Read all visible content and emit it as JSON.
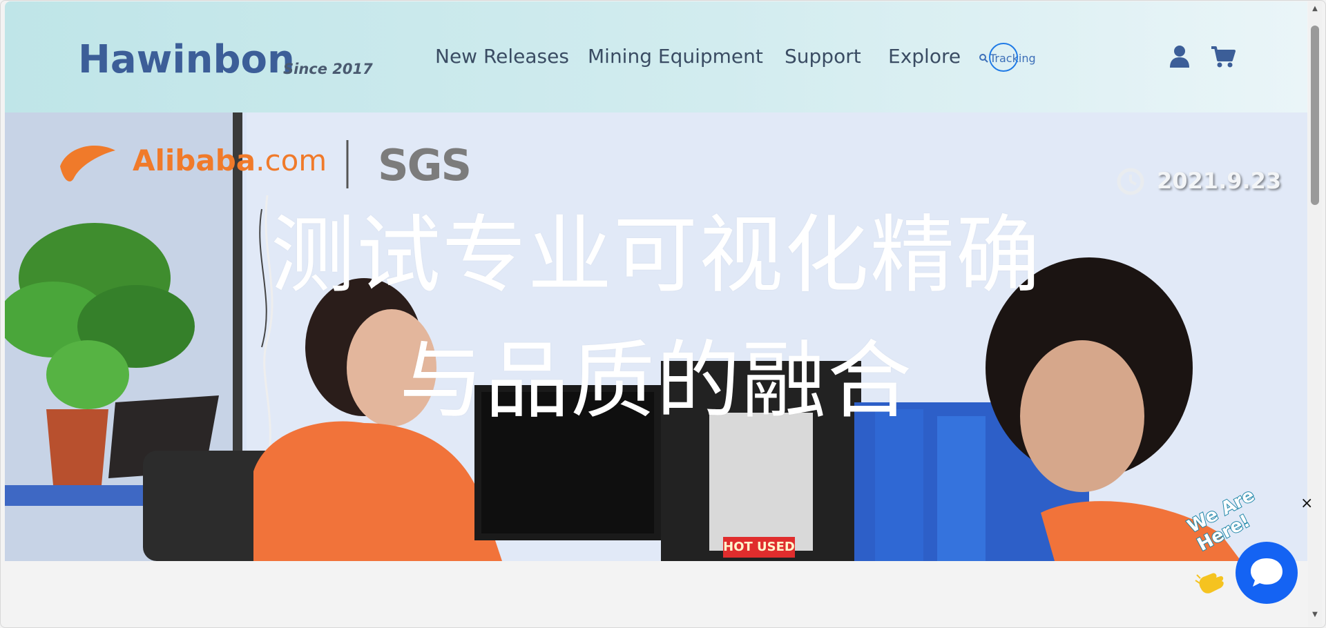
{
  "header": {
    "logo": "Hawinbon",
    "tagline": "Since 2017",
    "nav": [
      "New Releases",
      "Mining Equipment",
      "Support",
      "Explore"
    ],
    "tracking_label": "Tracking",
    "icons": [
      "search-icon",
      "user-icon",
      "cart-icon"
    ]
  },
  "hero": {
    "title_line1": "测试专业可视化精确",
    "title_line2": "与品质的融合",
    "date": "2021.9.23",
    "brand_logo": "Alibaba",
    "brand_logo_suffix": ".com",
    "cert_logo": "SGS",
    "monitor_label": "HOT USED MINER"
  },
  "chat": {
    "tagline": "We Are Here!",
    "close_label": "×"
  },
  "colors": {
    "logo": "#3c5e98",
    "nav_text": "#3a4c63",
    "accent_blue": "#1463f3",
    "header_bg_start": "#bfe5e8",
    "header_bg_end": "#eaf5f8"
  }
}
